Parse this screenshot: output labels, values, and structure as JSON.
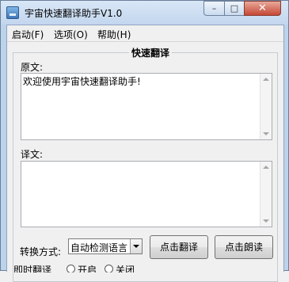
{
  "window": {
    "title": "宇宙快速翻译助手V1.0",
    "controls": {
      "minimize": "–",
      "maximize": "□",
      "close": "✕"
    }
  },
  "menu": [
    {
      "label": "启动(F)"
    },
    {
      "label": "选项(O)"
    },
    {
      "label": "帮助(H)"
    }
  ],
  "panel": {
    "title": "快速翻译",
    "source_label": "原文:",
    "source_text": "欢迎使用宇宙快速翻译助手!",
    "target_label": "译文:",
    "target_text": "",
    "mode_label": "转换方式:",
    "mode_value": "自动检测语言",
    "translate_button": "点击翻译",
    "read_button": "点击朗读",
    "instant_label": "即时翻译",
    "radio_on": "开启",
    "radio_off": "关闭"
  },
  "colors": {
    "title_bar": "#c2d6ee",
    "close_button": "#c64836",
    "window_bg": "#f0f0f0"
  }
}
